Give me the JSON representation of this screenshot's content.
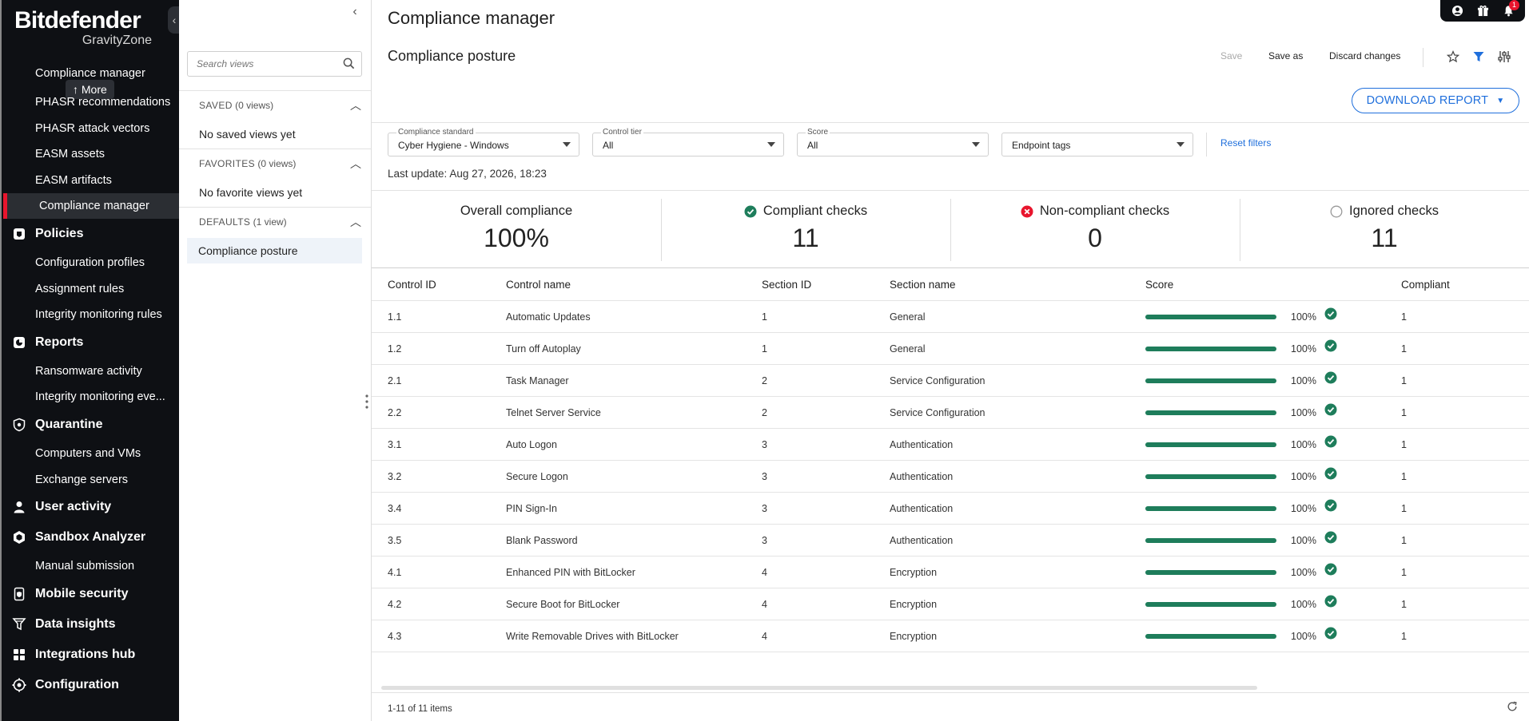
{
  "brand": {
    "name": "Bitdefender",
    "product": "GravityZone"
  },
  "nav": {
    "more_label": "More",
    "partial_item": "Compliance manager",
    "items": [
      {
        "type": "sub",
        "label": "PHASR recommendations"
      },
      {
        "type": "sub",
        "label": "PHASR attack vectors"
      },
      {
        "type": "sub",
        "label": "EASM assets"
      },
      {
        "type": "sub",
        "label": "EASM artifacts"
      },
      {
        "type": "sub",
        "label": "Compliance manager",
        "active": true
      },
      {
        "type": "section",
        "label": "Policies",
        "icon": "policies-icon"
      },
      {
        "type": "sub",
        "label": "Configuration profiles"
      },
      {
        "type": "sub",
        "label": "Assignment rules"
      },
      {
        "type": "sub",
        "label": "Integrity monitoring rules"
      },
      {
        "type": "section",
        "label": "Reports",
        "icon": "reports-icon"
      },
      {
        "type": "sub",
        "label": "Ransomware activity"
      },
      {
        "type": "sub",
        "label": "Integrity monitoring eve..."
      },
      {
        "type": "section",
        "label": "Quarantine",
        "icon": "quarantine-icon"
      },
      {
        "type": "sub",
        "label": "Computers and VMs"
      },
      {
        "type": "sub",
        "label": "Exchange servers"
      },
      {
        "type": "section",
        "label": "User activity",
        "icon": "user-icon"
      },
      {
        "type": "section",
        "label": "Sandbox Analyzer",
        "icon": "sandbox-icon"
      },
      {
        "type": "sub",
        "label": "Manual submission"
      },
      {
        "type": "section",
        "label": "Mobile security",
        "icon": "mobile-icon"
      },
      {
        "type": "section",
        "label": "Data insights",
        "icon": "data-insights-icon"
      },
      {
        "type": "section",
        "label": "Integrations hub",
        "icon": "integrations-icon"
      },
      {
        "type": "section",
        "label": "Configuration",
        "icon": "configuration-icon"
      }
    ]
  },
  "views": {
    "search_placeholder": "Search views",
    "saved": {
      "title": "SAVED",
      "count": "(0 views)",
      "empty": "No saved views yet"
    },
    "favorites": {
      "title": "FAVORITES",
      "count": "(0 views)",
      "empty": "No favorite views yet"
    },
    "defaults": {
      "title": "DEFAULTS",
      "count": "(1 view)",
      "items": [
        "Compliance posture"
      ]
    }
  },
  "header": {
    "page_title": "Compliance manager",
    "view_title": "Compliance posture",
    "save_label": "Save",
    "save_as_label": "Save as",
    "discard_label": "Discard changes",
    "download_label": "DOWNLOAD REPORT",
    "notifications_count": "1"
  },
  "filters": {
    "standard": {
      "label": "Compliance standard",
      "value": "Cyber Hygiene - Windows"
    },
    "tier": {
      "label": "Control tier",
      "value": "All"
    },
    "score": {
      "label": "Score",
      "value": "All"
    },
    "tags": {
      "label": "",
      "value": "Endpoint tags"
    },
    "reset_label": "Reset filters",
    "last_update": "Last update: Aug 27, 2026, 18:23"
  },
  "summary": [
    {
      "title": "Overall compliance",
      "value": "100%",
      "icon": ""
    },
    {
      "title": "Compliant checks",
      "value": "11",
      "icon": "check-circle-icon"
    },
    {
      "title": "Non-compliant checks",
      "value": "0",
      "icon": "error-circle-icon"
    },
    {
      "title": "Ignored checks",
      "value": "11",
      "icon": "empty-circle-icon"
    }
  ],
  "colors": {
    "accent": "#1f6fdc",
    "success": "#1e7d5b",
    "danger": "#e8152d",
    "nav_bg": "#0e1014"
  },
  "table": {
    "headers": [
      "Control ID",
      "Control name",
      "Section ID",
      "Section name",
      "Score",
      "Compliant"
    ],
    "rows": [
      {
        "id": "1.1",
        "name": "Automatic Updates",
        "section_id": "1",
        "section": "General",
        "score": 100,
        "score_label": "100%",
        "compliant": "1"
      },
      {
        "id": "1.2",
        "name": "Turn off Autoplay",
        "section_id": "1",
        "section": "General",
        "score": 100,
        "score_label": "100%",
        "compliant": "1"
      },
      {
        "id": "2.1",
        "name": "Task Manager",
        "section_id": "2",
        "section": "Service Configuration",
        "score": 100,
        "score_label": "100%",
        "compliant": "1"
      },
      {
        "id": "2.2",
        "name": "Telnet Server Service",
        "section_id": "2",
        "section": "Service Configuration",
        "score": 100,
        "score_label": "100%",
        "compliant": "1"
      },
      {
        "id": "3.1",
        "name": "Auto Logon",
        "section_id": "3",
        "section": "Authentication",
        "score": 100,
        "score_label": "100%",
        "compliant": "1"
      },
      {
        "id": "3.2",
        "name": "Secure Logon",
        "section_id": "3",
        "section": "Authentication",
        "score": 100,
        "score_label": "100%",
        "compliant": "1"
      },
      {
        "id": "3.4",
        "name": "PIN Sign-In",
        "section_id": "3",
        "section": "Authentication",
        "score": 100,
        "score_label": "100%",
        "compliant": "1"
      },
      {
        "id": "3.5",
        "name": "Blank Password",
        "section_id": "3",
        "section": "Authentication",
        "score": 100,
        "score_label": "100%",
        "compliant": "1"
      },
      {
        "id": "4.1",
        "name": "Enhanced PIN with BitLocker",
        "section_id": "4",
        "section": "Encryption",
        "score": 100,
        "score_label": "100%",
        "compliant": "1"
      },
      {
        "id": "4.2",
        "name": "Secure Boot for BitLocker",
        "section_id": "4",
        "section": "Encryption",
        "score": 100,
        "score_label": "100%",
        "compliant": "1"
      },
      {
        "id": "4.3",
        "name": "Write Removable Drives with BitLocker",
        "section_id": "4",
        "section": "Encryption",
        "score": 100,
        "score_label": "100%",
        "compliant": "1"
      }
    ],
    "pager": "1-11 of 11 items"
  }
}
